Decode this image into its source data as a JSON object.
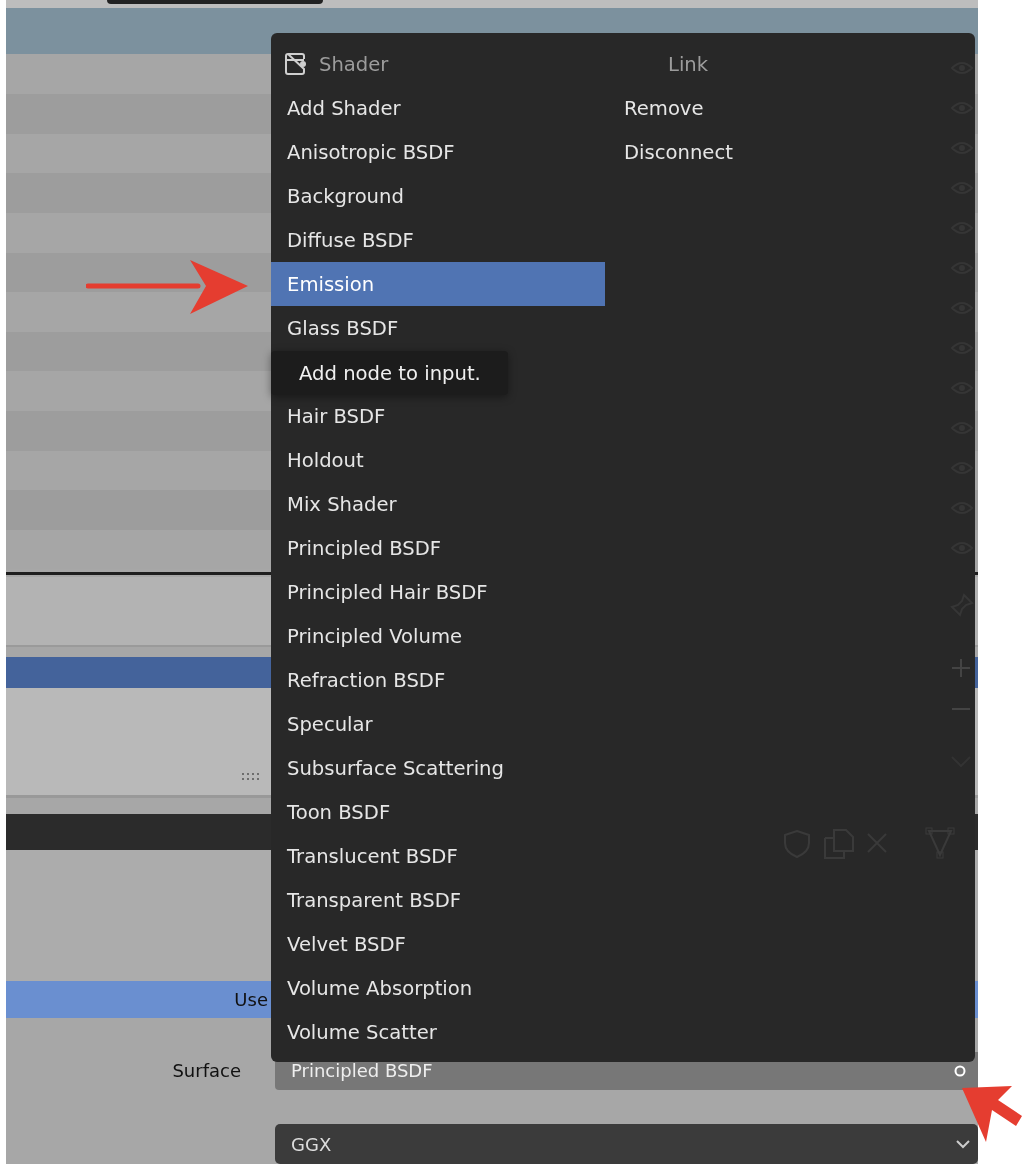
{
  "menu": {
    "columns": [
      {
        "header": "Shader",
        "items": [
          {
            "label": "Add Shader",
            "selected": false
          },
          {
            "label": "Anisotropic BSDF",
            "selected": false
          },
          {
            "label": "Background",
            "selected": false
          },
          {
            "label": "Diffuse BSDF",
            "selected": false
          },
          {
            "label": "Emission",
            "selected": true
          },
          {
            "label": "Glass BSDF",
            "selected": false
          },
          {
            "selected": false
          },
          {
            "label": "Hair BSDF",
            "selected": false
          },
          {
            "label": "Holdout",
            "selected": false
          },
          {
            "label": "Mix Shader",
            "selected": false
          },
          {
            "label": "Principled BSDF",
            "selected": false
          },
          {
            "label": "Principled Hair BSDF",
            "selected": false
          },
          {
            "label": "Principled Volume",
            "selected": false
          },
          {
            "label": "Refraction BSDF",
            "selected": false
          },
          {
            "label": "Specular",
            "selected": false
          },
          {
            "label": "Subsurface Scattering",
            "selected": false
          },
          {
            "label": "Toon BSDF",
            "selected": false
          },
          {
            "label": "Translucent BSDF",
            "selected": false
          },
          {
            "label": "Transparent BSDF",
            "selected": false
          },
          {
            "label": "Velvet BSDF",
            "selected": false
          },
          {
            "label": "Volume Absorption",
            "selected": false
          },
          {
            "label": "Volume Scatter",
            "selected": false
          }
        ]
      },
      {
        "header": "Link",
        "items": [
          {
            "label": "Remove",
            "selected": false
          },
          {
            "label": "Disconnect",
            "selected": false
          }
        ]
      }
    ]
  },
  "tooltip": {
    "text": "Add node to input."
  },
  "upper_list": {
    "rows": [
      {
        "selected": false
      },
      {
        "selected": false
      },
      {
        "selected": false
      },
      {
        "selected": false
      },
      {
        "selected": false
      },
      {
        "selected": false
      },
      {
        "selected": false
      },
      {
        "selected": false
      },
      {
        "selected": false
      },
      {
        "selected": false
      },
      {
        "selected": false
      },
      {
        "selected": false
      },
      {
        "selected": false
      }
    ]
  },
  "lower_list": {
    "rows": [
      {
        "selected": true
      }
    ]
  },
  "use_nodes_button": {
    "label": "Use"
  },
  "surface": {
    "label": "Surface",
    "value": "Principled BSDF"
  },
  "distribution": {
    "value": "GGX"
  }
}
